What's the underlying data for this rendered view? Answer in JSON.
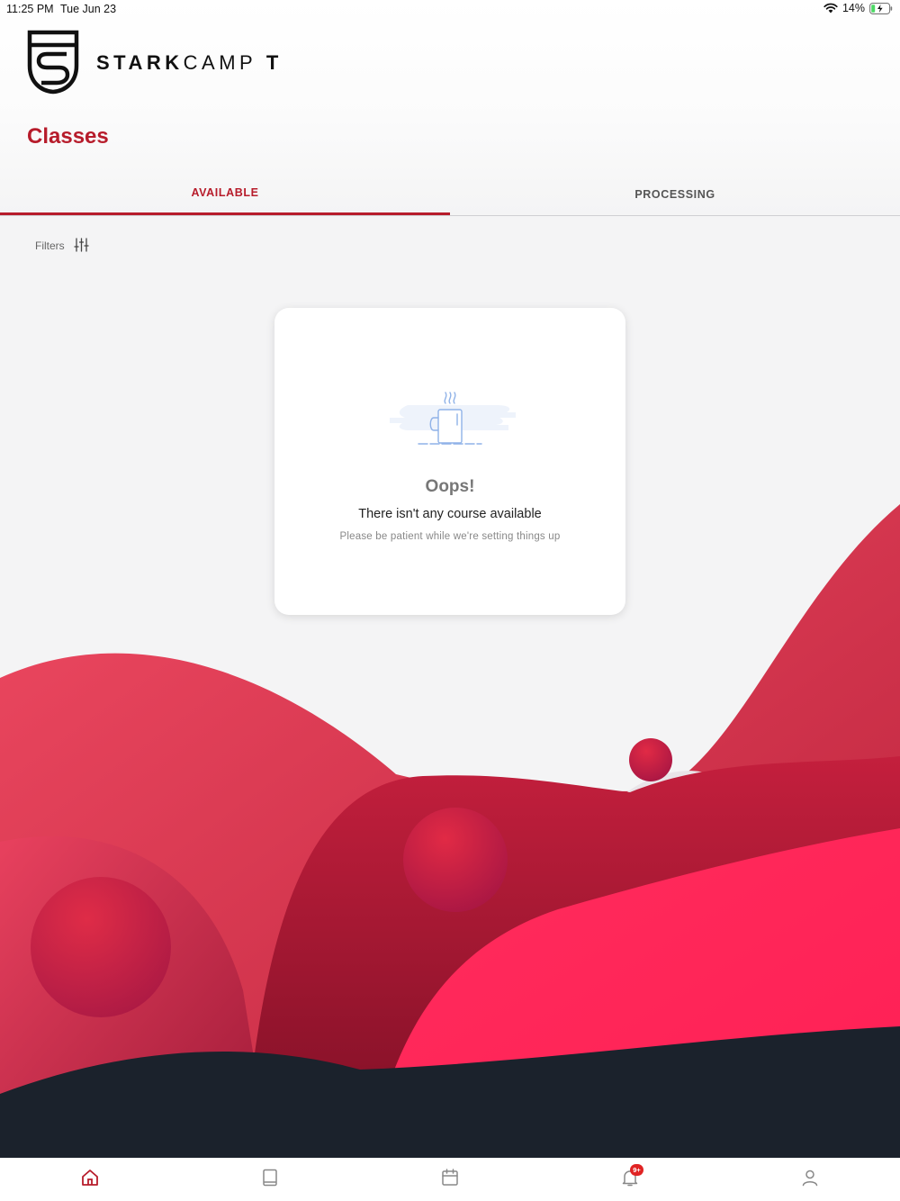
{
  "status_bar": {
    "time": "11:25 PM",
    "date": "Tue Jun 23",
    "battery": "14%",
    "icons": [
      "wifi-icon",
      "battery-charging-icon"
    ]
  },
  "brand": {
    "name_strong": "STARK",
    "name_light": "CAMP",
    "name_suffix": "T",
    "logo_icon": "shield-logo-icon",
    "accent_color": "#b71c2b"
  },
  "page": {
    "title": "Classes"
  },
  "tabs": [
    {
      "label": "AVAILABLE",
      "active": true
    },
    {
      "label": "PROCESSING",
      "active": false
    }
  ],
  "filters": {
    "label": "Filters",
    "icon": "sliders-icon"
  },
  "empty_state": {
    "illustration": "coffee-mug-icon",
    "title": "Oops!",
    "message": "There isn't any course available",
    "submessage": "Please be patient while we're setting things up"
  },
  "bottom_nav": {
    "items": [
      {
        "icon": "home-icon",
        "active": true
      },
      {
        "icon": "book-icon",
        "active": false
      },
      {
        "icon": "calendar-icon",
        "active": false
      },
      {
        "icon": "bell-icon",
        "active": false,
        "badge": "9+"
      },
      {
        "icon": "user-icon",
        "active": false
      }
    ]
  },
  "colors": {
    "wave_red": "#e3334f",
    "wave_dark_red": "#9e1632",
    "wave_bright": "#ff2356",
    "wave_navy": "#1b222c",
    "background": "#f4f4f5"
  }
}
